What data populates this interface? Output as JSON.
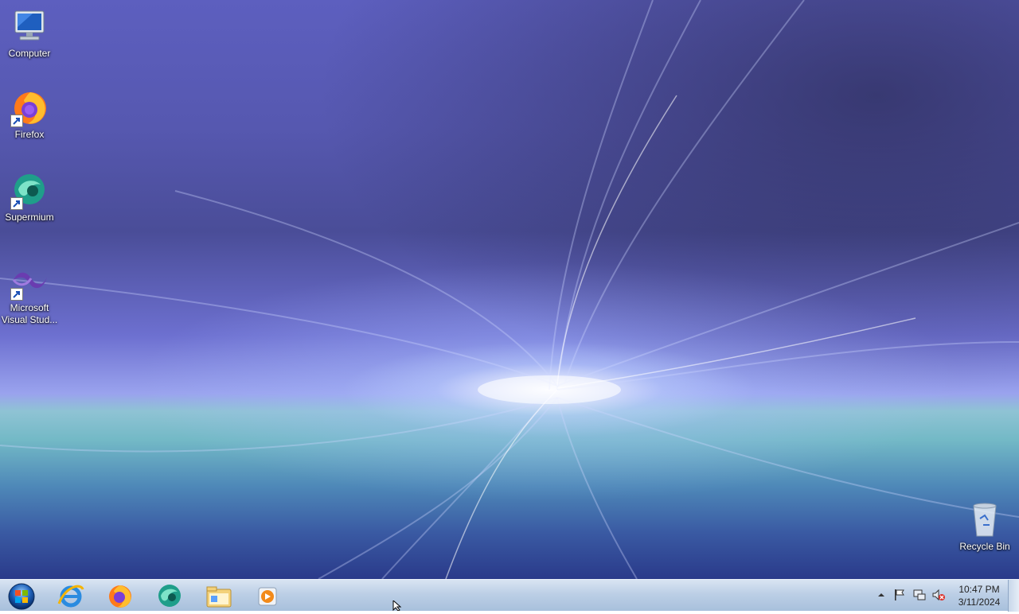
{
  "desktop": {
    "icons": [
      {
        "label": "Computer",
        "icon": "computer-icon"
      },
      {
        "label": "Firefox",
        "icon": "firefox-icon"
      },
      {
        "label": "Supermium",
        "icon": "supermium-icon"
      },
      {
        "label": "Microsoft\nVisual Stud...",
        "icon": "visual-studio-icon"
      },
      {
        "label": "Recycle Bin",
        "icon": "recycle-bin-icon"
      }
    ]
  },
  "taskbar": {
    "start": {
      "icon": "windows-orb-icon"
    },
    "pinned": [
      {
        "icon": "internet-explorer-icon"
      },
      {
        "icon": "firefox-icon"
      },
      {
        "icon": "supermium-icon"
      },
      {
        "icon": "file-explorer-icon"
      },
      {
        "icon": "media-player-icon"
      }
    ],
    "tray": {
      "icons": [
        "show-hidden-icons-arrow",
        "action-center-flag-icon",
        "network-icon",
        "volume-muted-icon"
      ],
      "time": "10:47 PM",
      "date": "3/11/2024"
    }
  },
  "colors": {
    "taskbar": "#bccfe6",
    "wallpaper_top": "#5d5fbf",
    "wallpaper_horizon": "#9aa3ee",
    "wallpaper_sea": "#4e88b8"
  }
}
